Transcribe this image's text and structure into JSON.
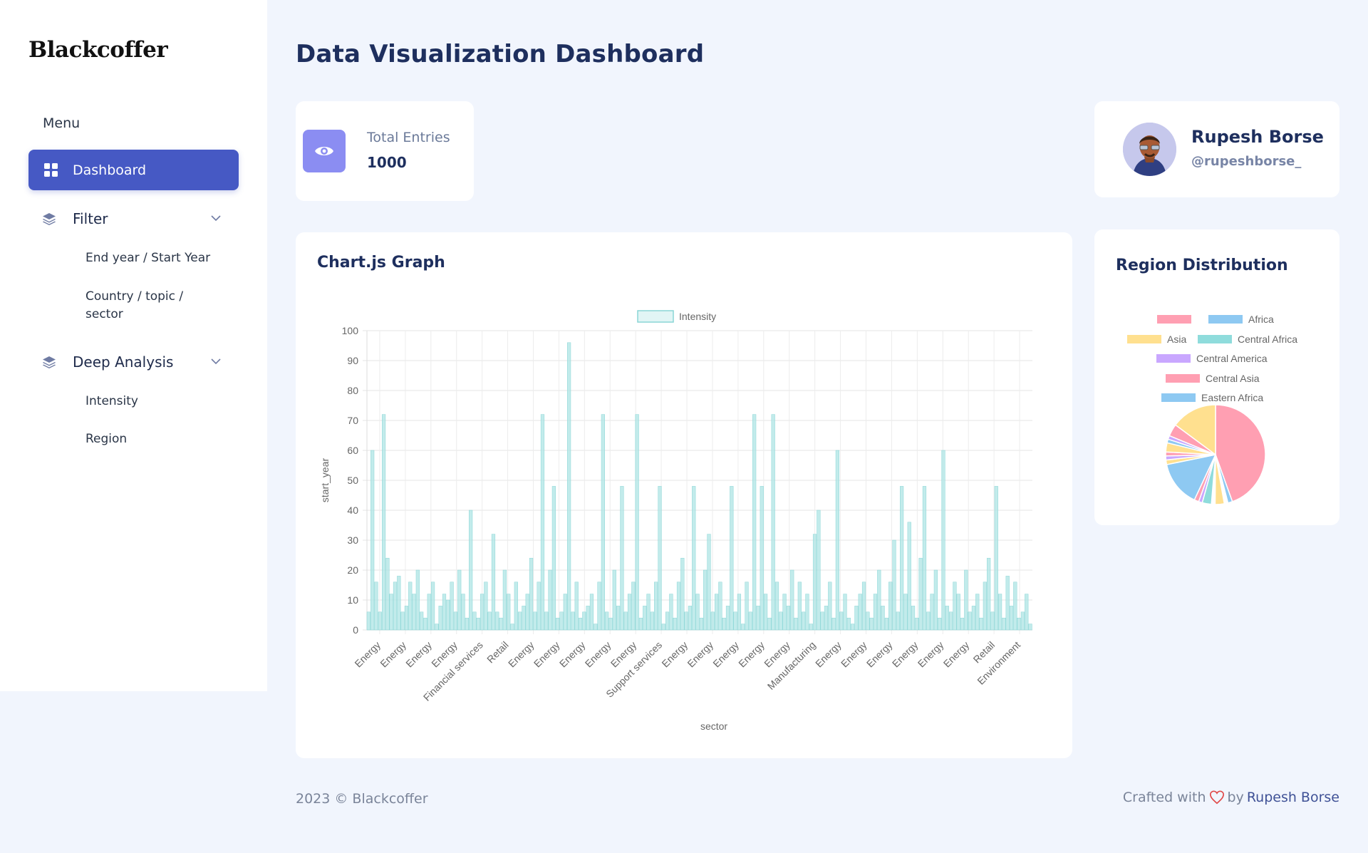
{
  "sidebar": {
    "logo": "Blackcoffer",
    "menu_heading": "Menu",
    "dashboard": "Dashboard",
    "filter": {
      "label": "Filter",
      "items": [
        "End year / Start Year",
        "Country / topic / sector"
      ]
    },
    "deep_analysis": {
      "label": "Deep Analysis",
      "items": [
        "Intensity",
        "Region"
      ]
    }
  },
  "header": {
    "title": "Data Visualization Dashboard"
  },
  "stats": {
    "label": "Total Entries",
    "value": "1000"
  },
  "profile": {
    "name": "Rupesh Borse",
    "handle": "@rupeshborse_"
  },
  "chart_card": {
    "title": "Chart.js Graph"
  },
  "region_card": {
    "title": "Region Distribution"
  },
  "footer": {
    "copyright": "2023 © Blackcoffer",
    "crafted_prefix": "Crafted with",
    "crafted_by": "by",
    "author": "Rupesh Borse"
  },
  "colors": {
    "accent": "#4659c4",
    "bar_fill": "#aee4e4",
    "bar_stroke": "#8ad6d6"
  },
  "chart_data": [
    {
      "type": "bar",
      "legend": [
        "Intensity"
      ],
      "legend_position": "top",
      "xlabel": "sector",
      "ylabel": "start_year",
      "ylim": [
        0,
        100
      ],
      "yticks": [
        0,
        10,
        20,
        30,
        40,
        50,
        60,
        70,
        80,
        90,
        100
      ],
      "grid": true,
      "tick_labels": [
        "Energy",
        "Energy",
        "Energy",
        "Energy",
        "Financial services",
        "Retail",
        "Energy",
        "Energy",
        "Energy",
        "Energy",
        "Energy",
        "Support services",
        "Energy",
        "Energy",
        "Energy",
        "Energy",
        "Energy",
        "Manufacturing",
        "Energy",
        "Energy",
        "Energy",
        "Energy",
        "Energy",
        "Energy",
        "Retail",
        "Environment"
      ],
      "series": [
        {
          "name": "Intensity",
          "values": [
            6,
            60,
            16,
            6,
            72,
            24,
            12,
            16,
            18,
            6,
            8,
            16,
            12,
            20,
            6,
            4,
            12,
            16,
            2,
            8,
            12,
            10,
            16,
            6,
            20,
            12,
            4,
            40,
            6,
            4,
            12,
            16,
            6,
            32,
            6,
            4,
            20,
            12,
            2,
            16,
            6,
            8,
            12,
            24,
            6,
            16,
            72,
            6,
            20,
            48,
            4,
            6,
            12,
            96,
            6,
            16,
            4,
            6,
            8,
            12,
            2,
            16,
            72,
            6,
            4,
            20,
            8,
            48,
            6,
            12,
            16,
            72,
            4,
            8,
            12,
            6,
            16,
            48,
            2,
            6,
            12,
            4,
            16,
            24,
            6,
            8,
            48,
            12,
            4,
            20,
            32,
            6,
            12,
            16,
            4,
            8,
            48,
            6,
            12,
            2,
            16,
            6,
            72,
            8,
            48,
            12,
            4,
            72,
            16,
            6,
            12,
            8,
            20,
            4,
            16,
            6,
            12,
            2,
            32,
            40,
            6,
            8,
            16,
            4,
            60,
            6,
            12,
            4,
            2,
            8,
            12,
            16,
            6,
            4,
            12,
            20,
            8,
            4,
            16,
            30,
            6,
            48,
            12,
            36,
            8,
            4,
            24,
            48,
            6,
            12,
            20,
            4,
            60,
            8,
            6,
            16,
            12,
            4,
            20,
            6,
            8,
            12,
            4,
            16,
            24,
            6,
            48,
            12,
            4,
            18,
            8,
            16,
            4,
            6,
            12,
            2
          ]
        }
      ]
    },
    {
      "type": "pie",
      "legend": [
        "",
        "Africa",
        "Asia",
        "Central Africa",
        "Central America",
        "Central Asia",
        "Eastern Africa"
      ],
      "legend_colors": [
        "#ff9fb2",
        "#8ec9f2",
        "#ffe08f",
        "#8fdcdc",
        "#c9a7ff",
        "#ff9fb2",
        "#8ec9f2"
      ],
      "slices": [
        {
          "value": 45,
          "color": "#ff9fb2"
        },
        {
          "value": 1.5,
          "color": "#8ec9f2"
        },
        {
          "value": 1.2,
          "color": "#ffffff"
        },
        {
          "value": 3,
          "color": "#ffe08f"
        },
        {
          "value": 1.2,
          "color": "#ffffff"
        },
        {
          "value": 3,
          "color": "#8fdcdc"
        },
        {
          "value": 1.2,
          "color": "#c9a7ff"
        },
        {
          "value": 1.5,
          "color": "#ff9fb2"
        },
        {
          "value": 15,
          "color": "#8ec9f2"
        },
        {
          "value": 1.5,
          "color": "#ffe08f"
        },
        {
          "value": 1.3,
          "color": "#c9a7ff"
        },
        {
          "value": 1.3,
          "color": "#ff9fb2"
        },
        {
          "value": 3,
          "color": "#ffe08f"
        },
        {
          "value": 1.2,
          "color": "#8ec9f2"
        },
        {
          "value": 1.2,
          "color": "#c9a7ff"
        },
        {
          "value": 4,
          "color": "#ff9fb2"
        },
        {
          "value": 15,
          "color": "#ffe08f"
        }
      ]
    }
  ]
}
